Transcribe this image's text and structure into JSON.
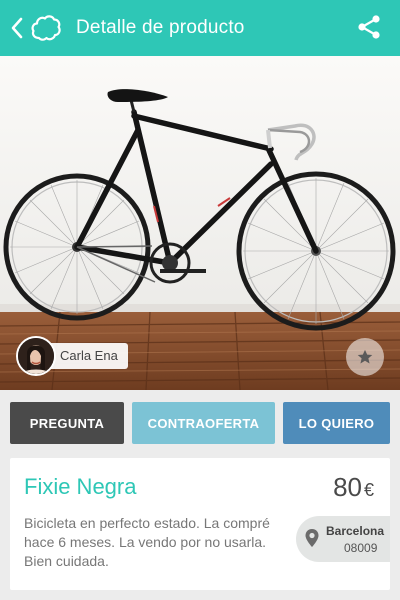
{
  "appbar": {
    "title": "Detalle de producto",
    "icons": {
      "back": "chevron-left-icon",
      "logo": "cloud-logo-icon",
      "share": "share-icon"
    },
    "color": "#2ec7b6"
  },
  "photo": {
    "subject": "bicycle"
  },
  "seller": {
    "name": "Carla Ena"
  },
  "favorite": {
    "icon": "star-icon"
  },
  "actions": {
    "ask": "PREGUNTA",
    "counteroffer": "CONTRAOFERTA",
    "want": "LO QUIERO",
    "colors": {
      "ask": "#4a4a4a",
      "counteroffer": "#7cc3d5",
      "want": "#4f8cba"
    }
  },
  "product": {
    "title": "Fixie Negra",
    "price": "80",
    "currency": "€",
    "description": "Bicicleta en perfecto estado. La compré hace 6 meses. La vendo por no usarla. Bien cuidada.",
    "location": {
      "city": "Barcelona",
      "zip": "08009",
      "icon": "map-pin-icon"
    }
  }
}
